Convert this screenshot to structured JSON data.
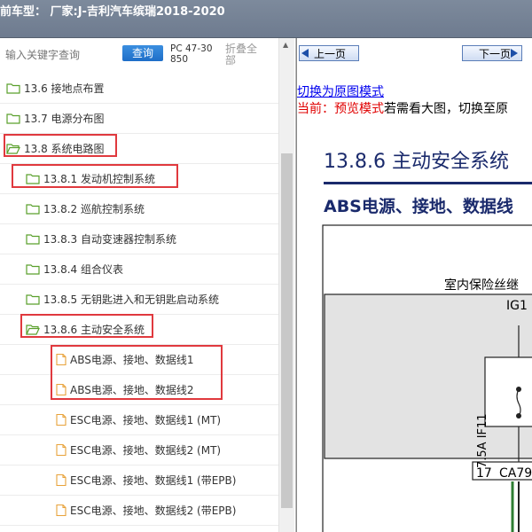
{
  "header": {
    "title": "前车型：  厂家:J-吉利汽车缤瑞2018-2020"
  },
  "toolbar": {
    "search_placeholder": "输入关键字查询",
    "query_label": "查询",
    "code": "PC 47-30850",
    "collapse_label": "折叠全部"
  },
  "tree": {
    "items": [
      {
        "label": "13.6 接地点布置",
        "type": "folder"
      },
      {
        "label": "13.7 电源分布图",
        "type": "folder"
      },
      {
        "label": "13.8 系统电路图",
        "type": "folder-open"
      },
      {
        "label": "13.8.1 发动机控制系统",
        "type": "folder"
      },
      {
        "label": "13.8.2 巡航控制系统",
        "type": "folder"
      },
      {
        "label": "13.8.3 自动变速器控制系统",
        "type": "folder"
      },
      {
        "label": "13.8.4 组合仪表",
        "type": "folder"
      },
      {
        "label": "13.8.5 无钥匙进入和无钥匙启动系统",
        "type": "folder"
      },
      {
        "label": "13.8.6 主动安全系统",
        "type": "folder-open"
      },
      {
        "label": "ABS电源、接地、数据线1",
        "type": "doc"
      },
      {
        "label": "ABS电源、接地、数据线2",
        "type": "doc"
      },
      {
        "label": "ESC电源、接地、数据线1 (MT)",
        "type": "doc"
      },
      {
        "label": "ESC电源、接地、数据线2 (MT)",
        "type": "doc"
      },
      {
        "label": "ESC电源、接地、数据线1 (带EPB)",
        "type": "doc"
      },
      {
        "label": "ESC电源、接地、数据线2 (带EPB)",
        "type": "doc"
      }
    ]
  },
  "viewer": {
    "prev_label": "上一页",
    "next_label": "下一页",
    "switch_link": "切换为原图模式",
    "mode_prefix": "当前：预览模式",
    "mode_suffix": "若需看大图，切换至原",
    "doc_title": "13.8.6 主动安全系统",
    "doc_subtitle": "ABS电源、接地、数据线",
    "diagram": {
      "fuse_box": "室内保险丝继",
      "ig1": "IG1",
      "fuse": "7.5A IF11",
      "pin": "17",
      "connector": "CA79"
    }
  },
  "colors": {
    "highlight": "#e0393e",
    "folder": "#5aa02c",
    "doc_icon": "#e8a23a",
    "title_blue": "#1a2a6c"
  }
}
